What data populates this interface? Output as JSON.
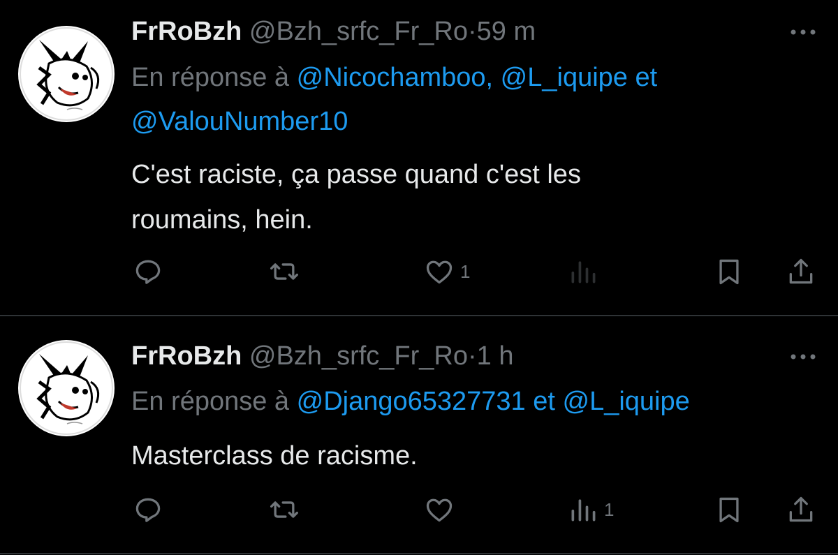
{
  "tweets": [
    {
      "display_name": "FrRoBzh",
      "handle": "@Bzh_srfc_Fr_Ro",
      "separator": "·",
      "time": "59 m",
      "reply_prefix": "En réponse à",
      "mentions_line1": "@Nicochamboo, @L_iquipe et",
      "mentions_line2": "@ValouNumber10",
      "text_line1": "C'est raciste, ça passe quand c'est les",
      "text_line2": "roumains, hein.",
      "like_count": "1",
      "views_count": ""
    },
    {
      "display_name": "FrRoBzh",
      "handle": "@Bzh_srfc_Fr_Ro",
      "separator": "·",
      "time": "1 h",
      "reply_prefix": "En réponse à",
      "mentions": "@Django65327731 et @L_iquipe",
      "text": "Masterclass de racisme.",
      "like_count": "",
      "views_count": "1"
    }
  ],
  "icons": [
    "more-icon",
    "reply-icon",
    "retweet-icon",
    "like-icon",
    "views-icon",
    "bookmark-icon",
    "share-icon"
  ],
  "colors": {
    "background": "#000000",
    "text": "#e7e9ea",
    "muted": "#71767b",
    "link": "#1d9bf0",
    "divider": "#2f3336"
  }
}
